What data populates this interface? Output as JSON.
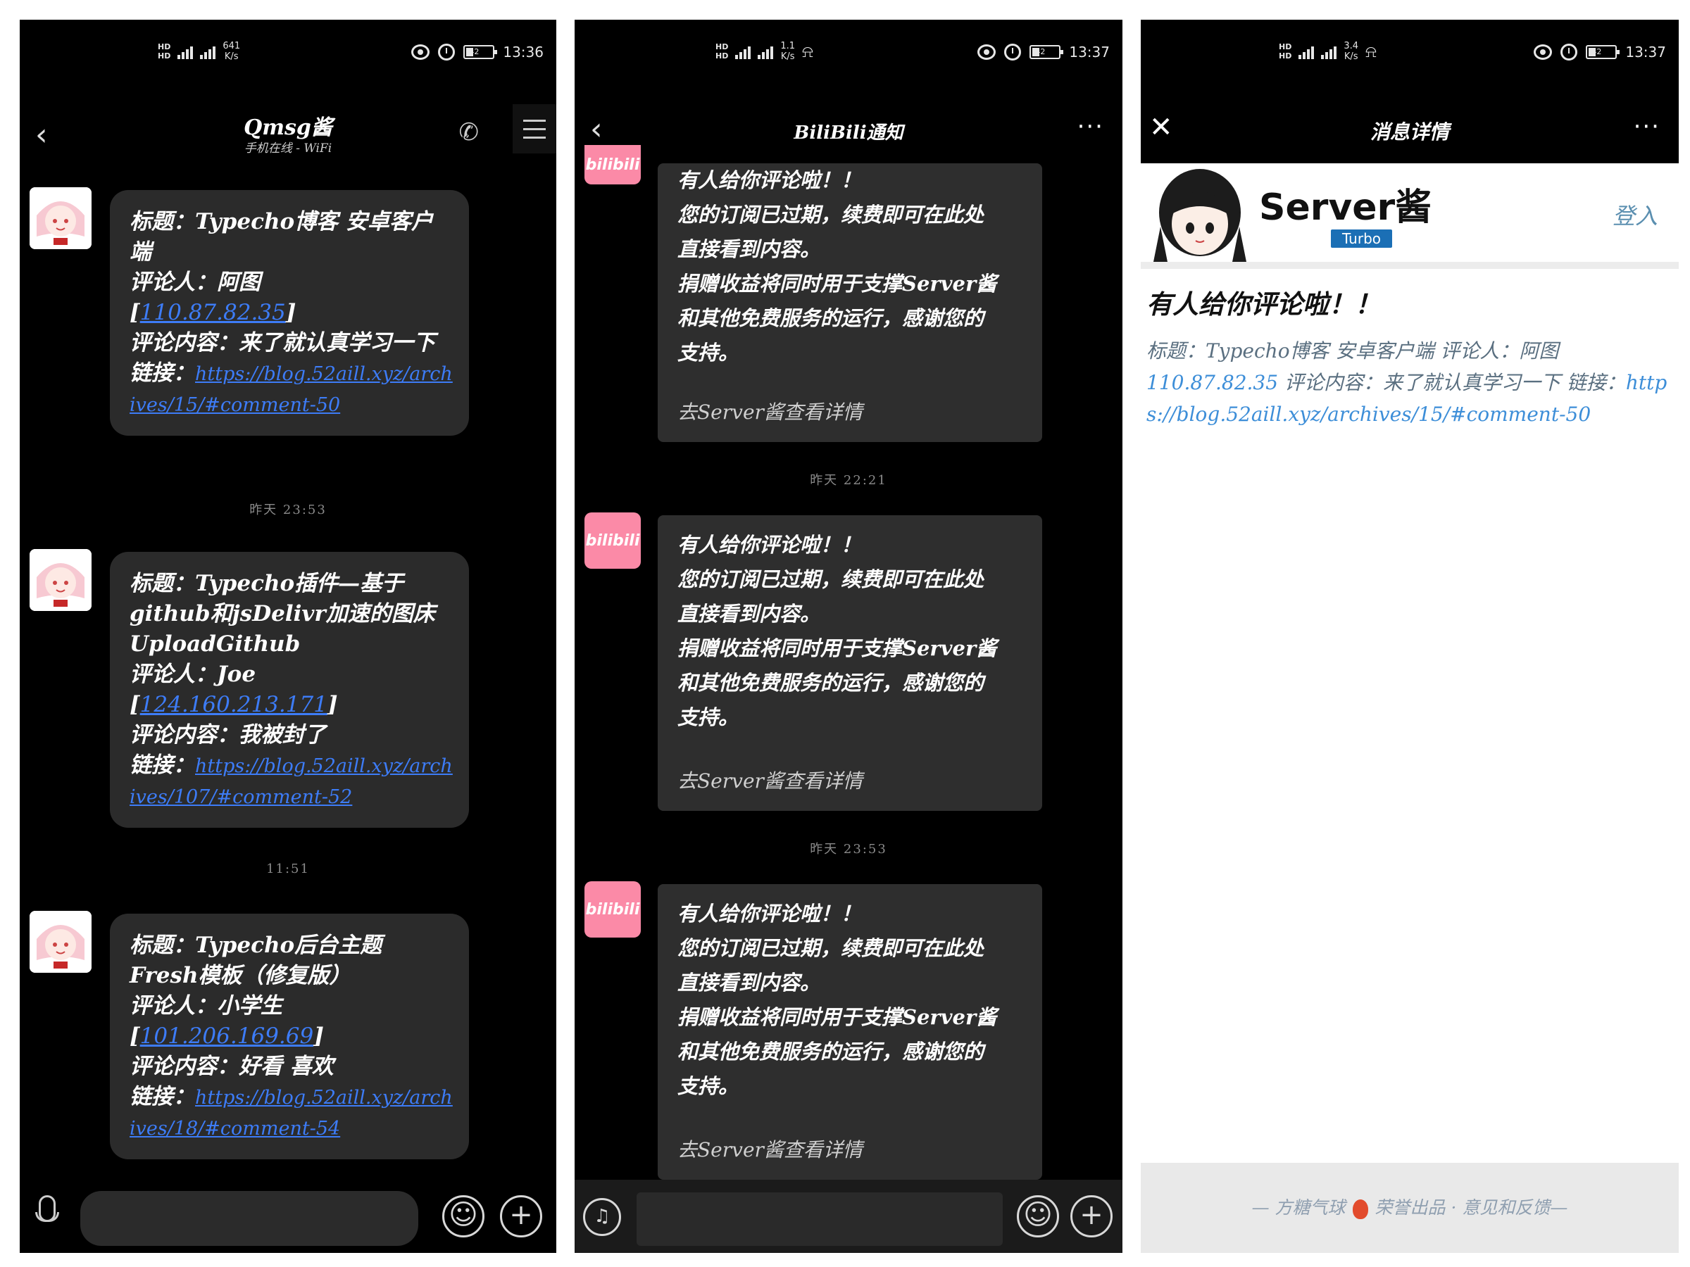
{
  "screen1": {
    "status": {
      "hd1": "HD",
      "hd2": "HD",
      "net1": "4G",
      "net2": "4G",
      "speed_value": "641",
      "speed_unit": "K/s",
      "battery": "42",
      "time": "13:36"
    },
    "title": "Qmsg酱",
    "subtitle": "手机在线 - WiFi",
    "messages": [
      {
        "line1": "标题：Typecho博客 安卓客户端",
        "line2": "评论人：阿图",
        "ip": "110.87.82.35",
        "line3": "评论内容：来了就认真学习一下",
        "link_label": "链接：",
        "link": "https://blog.52aill.xyz/archives/15/#comment-50"
      },
      {
        "line1": "标题：Typecho插件—基于github和jsDelivr加速的图床UploadGithub",
        "line2": "评论人：Joe",
        "ip": "124.160.213.171",
        "line3": "评论内容：我被封了",
        "link_label": "链接：",
        "link": "https://blog.52aill.xyz/archives/107/#comment-52"
      },
      {
        "line1": "标题：Typecho后台主题 Fresh模板（修复版）",
        "line2": "评论人：小学生",
        "ip": "101.206.169.69",
        "line3": "评论内容：好看 喜欢",
        "link_label": "链接：",
        "link": "https://blog.52aill.xyz/archives/18/#comment-54"
      }
    ],
    "times": [
      "昨天 23:53",
      "11:51"
    ]
  },
  "screen2": {
    "status": {
      "hd1": "HD",
      "hd2": "HD",
      "net1": "4G",
      "net2": "4G",
      "speed_value": "1.1",
      "speed_unit": "K/s",
      "battery": "42",
      "time": "13:37"
    },
    "title": "BiliBili通知",
    "more": "···",
    "avatar_label": "bilibili",
    "message": {
      "l1": "有人给你评论啦！！",
      "l2": "您的订阅已过期，续费即可在此处",
      "l3": "直接看到内容。",
      "l4": "捐赠收益将同时用于支撑Server酱",
      "l5": "和其他免费服务的运行，感谢您的",
      "l6": "支持。",
      "detail": "去Server酱查看详情"
    },
    "times": [
      "昨天 22:21",
      "昨天 23:53"
    ]
  },
  "screen3": {
    "status": {
      "hd1": "HD",
      "hd2": "HD",
      "net1": "4G",
      "net2": "4G",
      "speed_value": "3.4",
      "speed_unit": "K/s",
      "battery": "42",
      "time": "13:37"
    },
    "title": "消息详情",
    "more": "···",
    "brand": "Server酱",
    "turbo": "Turbo",
    "login": "登入",
    "msg_title": "有人给你评论啦！！",
    "body_label": "标题：Typecho博客 安卓客户端 评论人：阿图",
    "body_ip": "110.87.82.35",
    "body_content": "评论内容：来了就认真学习一下",
    "body_link_label": "链接：",
    "body_link": "https://blog.52aill.xyz/archives/15/#comment-50",
    "footer_left": "— 方糖气球",
    "footer_right": "荣誉出品 · 意见和反馈—"
  }
}
